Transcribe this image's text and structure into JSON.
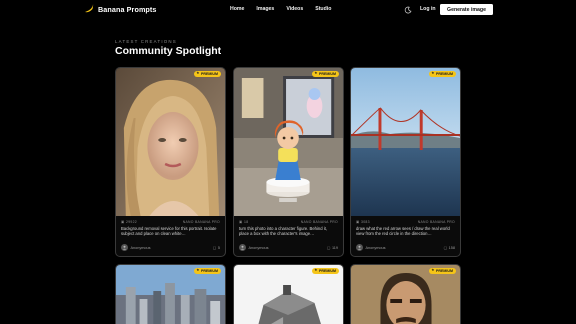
{
  "brand": {
    "name": "Banana Prompts"
  },
  "nav": {
    "items": [
      "Home",
      "Images",
      "Videos",
      "Studio"
    ]
  },
  "header": {
    "login": "Log in",
    "cta": "Generate image"
  },
  "section": {
    "eyebrow": "LATEST CREATIONS",
    "title": "Community Spotlight"
  },
  "colors": {
    "badge": "#f5c518",
    "background": "#000000",
    "card_border": "#3a3a3a"
  },
  "cards": [
    {
      "badge": "PREMIUM",
      "count": "29922",
      "model": "NANO BANANA PRO",
      "description": "Background removal service for this portrait. Isolate subject and place on clean white…",
      "author": "Anonymous",
      "comments": "5"
    },
    {
      "badge": "PREMIUM",
      "count": "18",
      "model": "NANO BANANA PRO",
      "description": "turn this photo into a character figure. Behind it, place a box with the character's image…",
      "author": "Anonymous",
      "comments": "119"
    },
    {
      "badge": "PREMIUM",
      "count": "3083",
      "model": "NANO BANANA PRO",
      "description": "draw what the red arrow sees / draw the real world view from the red circle in the direction…",
      "author": "Anonymous",
      "comments": "158"
    },
    {
      "badge": "PREMIUM"
    },
    {
      "badge": "PREMIUM"
    },
    {
      "badge": "PREMIUM"
    }
  ]
}
